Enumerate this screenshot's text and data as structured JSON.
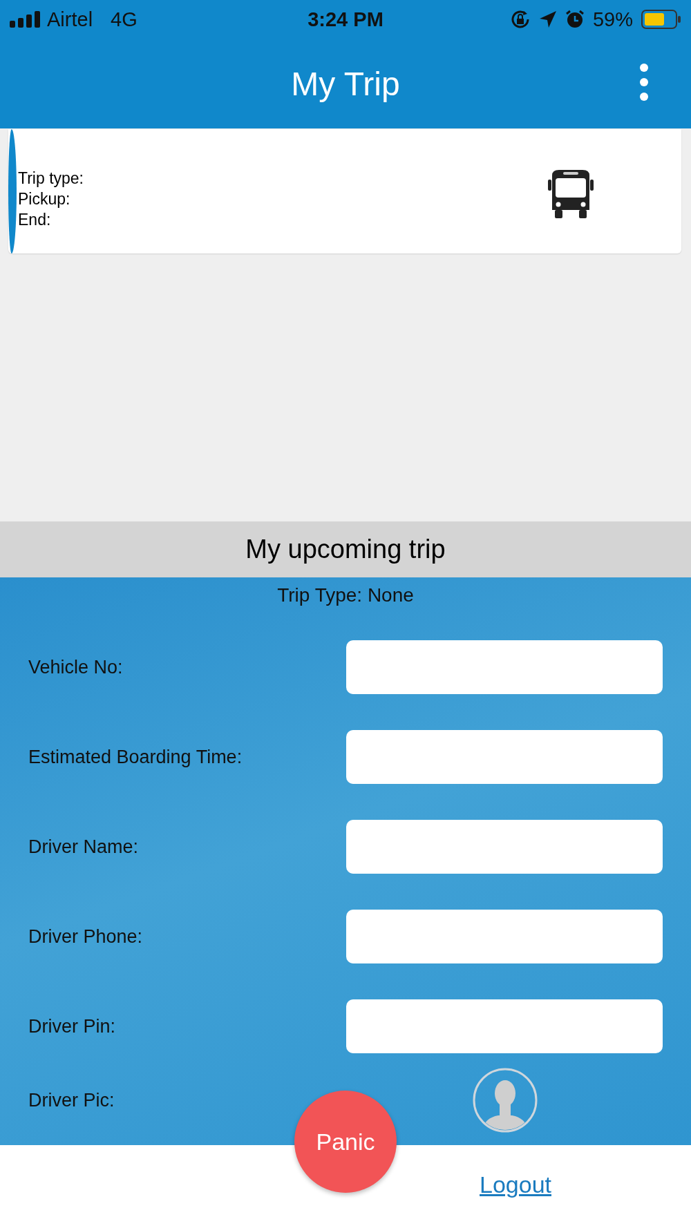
{
  "status_bar": {
    "carrier": "Airtel",
    "network": "4G",
    "time": "3:24 PM",
    "battery": "59%"
  },
  "header": {
    "title": "My Trip"
  },
  "trip_card": {
    "lines": [
      "Trip type:",
      "Pickup:",
      "End:"
    ]
  },
  "upcoming": {
    "title": "My upcoming trip",
    "trip_type": "Trip Type: None",
    "fields": [
      {
        "label": "Vehicle No:"
      },
      {
        "label": "Estimated Boarding Time:"
      },
      {
        "label": "Driver Name:"
      },
      {
        "label": "Driver Phone:"
      },
      {
        "label": "Driver Pin:"
      }
    ],
    "pic_label": "Driver Pic:"
  },
  "panic_button": "Panic",
  "logout_link": "Logout"
}
